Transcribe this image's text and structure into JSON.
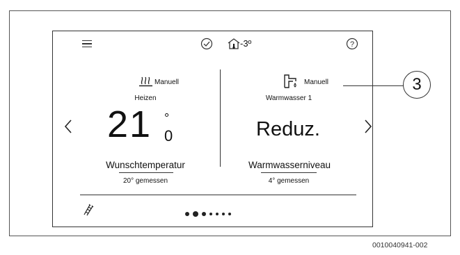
{
  "header": {
    "outdoor_temp": "-3º"
  },
  "heating": {
    "mode": "Manuell",
    "title": "Heizen",
    "set_temp_main": "21",
    "set_temp_decimal": "0",
    "degree": "°",
    "subtitle": "Wunschtemperatur",
    "measured": "20° gemessen"
  },
  "hot_water": {
    "mode": "Manuell",
    "title": "Warmwasser 1",
    "level": "Reduz.",
    "subtitle": "Warmwasserniveau",
    "measured": "4° gemessen"
  },
  "pagination": {
    "total": 7,
    "active": 2
  },
  "callout_number": "3",
  "document_id": "0010040941-002",
  "icons": {
    "menu": "menu-icon",
    "status": "check-circle-icon",
    "house": "house-thermometer-icon",
    "help": "help-icon",
    "heat": "heating-icon",
    "tap": "faucet-icon",
    "ladder": "service-ladder-icon"
  }
}
